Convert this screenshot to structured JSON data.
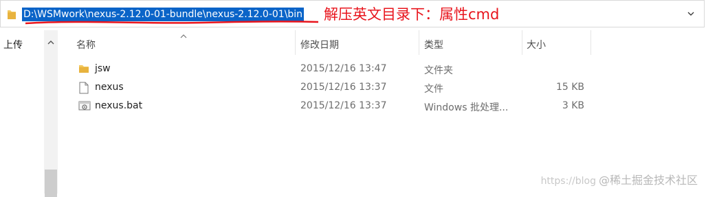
{
  "address_bar": {
    "path": "D:\\WSMwork\\nexus-2.12.0-01-bundle\\nexus-2.12.0-01\\bin",
    "annotation": "解压英文目录下：属性cmd"
  },
  "nav": {
    "item_label": "上传"
  },
  "columns": {
    "name": "名称",
    "modified": "修改日期",
    "type": "类型",
    "size": "大小"
  },
  "files": [
    {
      "name": "jsw",
      "modified": "2015/12/16 13:47",
      "type": "文件夹",
      "size": "",
      "icon": "folder-icon"
    },
    {
      "name": "nexus",
      "modified": "2015/12/16 13:37",
      "type": "文件",
      "size": "15 KB",
      "icon": "file-icon"
    },
    {
      "name": "nexus.bat",
      "modified": "2015/12/16 13:37",
      "type": "Windows 批处理...",
      "size": "3 KB",
      "icon": "batch-file-icon"
    }
  ],
  "colors": {
    "selection": "#0a64c8",
    "annotation": "#e8141c",
    "folder": "#f2c75c"
  },
  "watermark": {
    "url": "https://blog",
    "text": "@稀土掘金技术社区"
  }
}
